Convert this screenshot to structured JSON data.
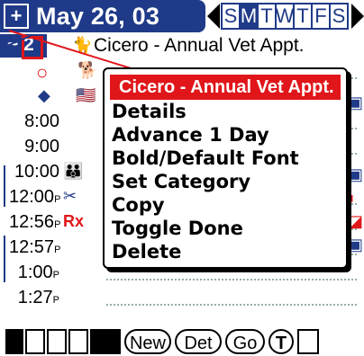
{
  "header": {
    "date": "May 26, 03",
    "days": [
      "S",
      "M",
      "T",
      "W",
      "T",
      "F",
      "S"
    ],
    "selected_day_index": 1
  },
  "appointment": {
    "title": "Cicero - Annual Vet Appt.",
    "selection_text": "~ 2"
  },
  "times": [
    "8:00",
    "9:00",
    "10:00",
    "12:00",
    "12:56",
    "12:57",
    "1:00",
    "1:27"
  ],
  "time_suffix": "P",
  "menu": {
    "header": "Cicero - Annual Vet Appt.",
    "items": [
      "Details",
      "Advance 1 Day",
      "Bold/Default Font",
      "Set Category",
      "Copy",
      "Toggle Done",
      "Delete"
    ]
  },
  "edge_fragments": [
    "t"
  ],
  "toolbar": {
    "new": "New",
    "det": "Det",
    "go": "Go",
    "t": "T"
  },
  "colors": {
    "brand_blue": "#1f3a88",
    "accent_red": "#e0161a"
  }
}
